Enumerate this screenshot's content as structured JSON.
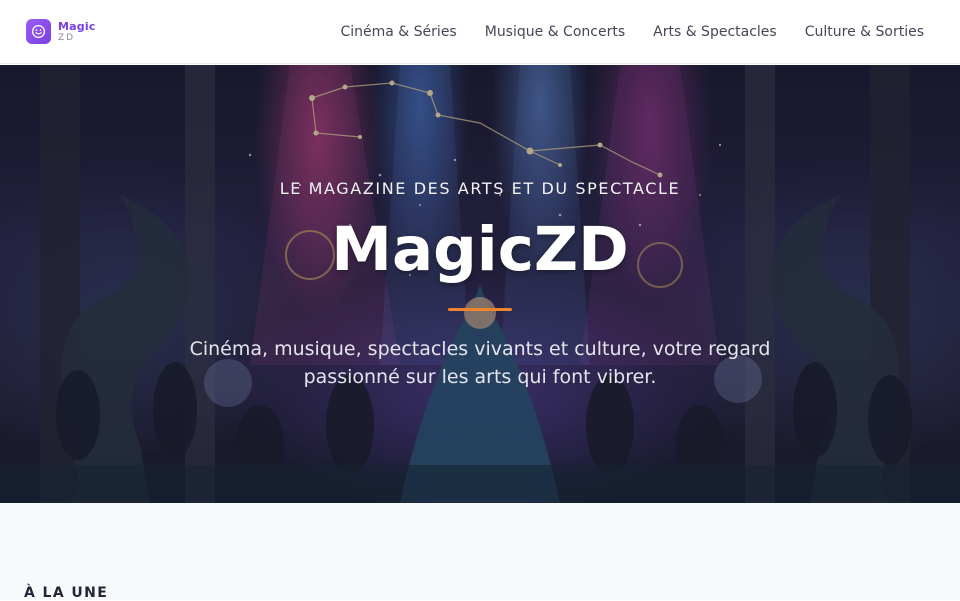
{
  "header": {
    "logo_title": "Magic",
    "logo_sub": "ZD",
    "logo_icon": "smiley-icon",
    "nav": [
      {
        "label": "Cinéma & Séries"
      },
      {
        "label": "Musique & Concerts"
      },
      {
        "label": "Arts & Spectacles"
      },
      {
        "label": "Culture & Sorties"
      }
    ]
  },
  "hero": {
    "kicker": "LE MAGAZINE DES ARTS ET DU SPECTACLE",
    "title": "MagicZD",
    "description": "Cinéma, musique, spectacles vivants et culture, votre regard passionné sur les arts qui font vibrer.",
    "accent_color": "#f0842c"
  },
  "main": {
    "section_label": "À LA UNE"
  },
  "colors": {
    "brand": "#7a3fe4",
    "nav_text": "#44475a",
    "page_bg": "#f7f9fc"
  }
}
